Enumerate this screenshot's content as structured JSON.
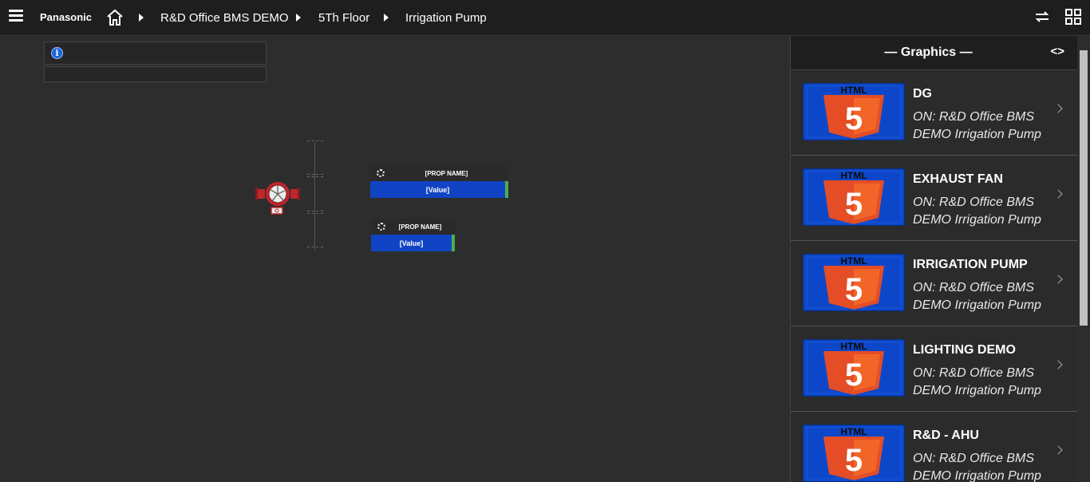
{
  "topbar": {
    "brand": "Panasonic",
    "breadcrumbs": [
      "R&D Office BMS DEMO",
      "5Th Floor",
      "Irrigation Pump"
    ]
  },
  "icons": {
    "menu": "hamburger-icon",
    "home": "home-icon",
    "sync": "sync-icon",
    "grid": "grid-icon",
    "info": "info-icon",
    "collapse": "code-brackets-icon"
  },
  "canvas": {
    "props": [
      {
        "name": "[PROP NAME]",
        "value": "[Value]"
      },
      {
        "name": "[PROP NAME]",
        "value": "[Value]"
      }
    ]
  },
  "panel": {
    "title": "— Graphics —",
    "collapse_glyph": "<>",
    "items": [
      {
        "title": "DG",
        "subtitle": "ON: R&D Office BMS DEMO Irrigation Pump"
      },
      {
        "title": "EXHAUST FAN",
        "subtitle": "ON: R&D Office BMS DEMO Irrigation Pump"
      },
      {
        "title": "IRRIGATION PUMP",
        "subtitle": "ON: R&D Office BMS DEMO Irrigation Pump"
      },
      {
        "title": "LIGHTING DEMO",
        "subtitle": "ON: R&D Office BMS DEMO Irrigation Pump"
      },
      {
        "title": "R&D - AHU",
        "subtitle": "ON: R&D Office BMS DEMO Irrigation Pump"
      }
    ],
    "thumb_label": "HTML",
    "thumb_digit": "5"
  },
  "colors": {
    "value_bg": "#1144c4",
    "status_green": "#4caf50",
    "html5_orange": "#e44d26",
    "thumb_bg": "#0d47c9"
  }
}
